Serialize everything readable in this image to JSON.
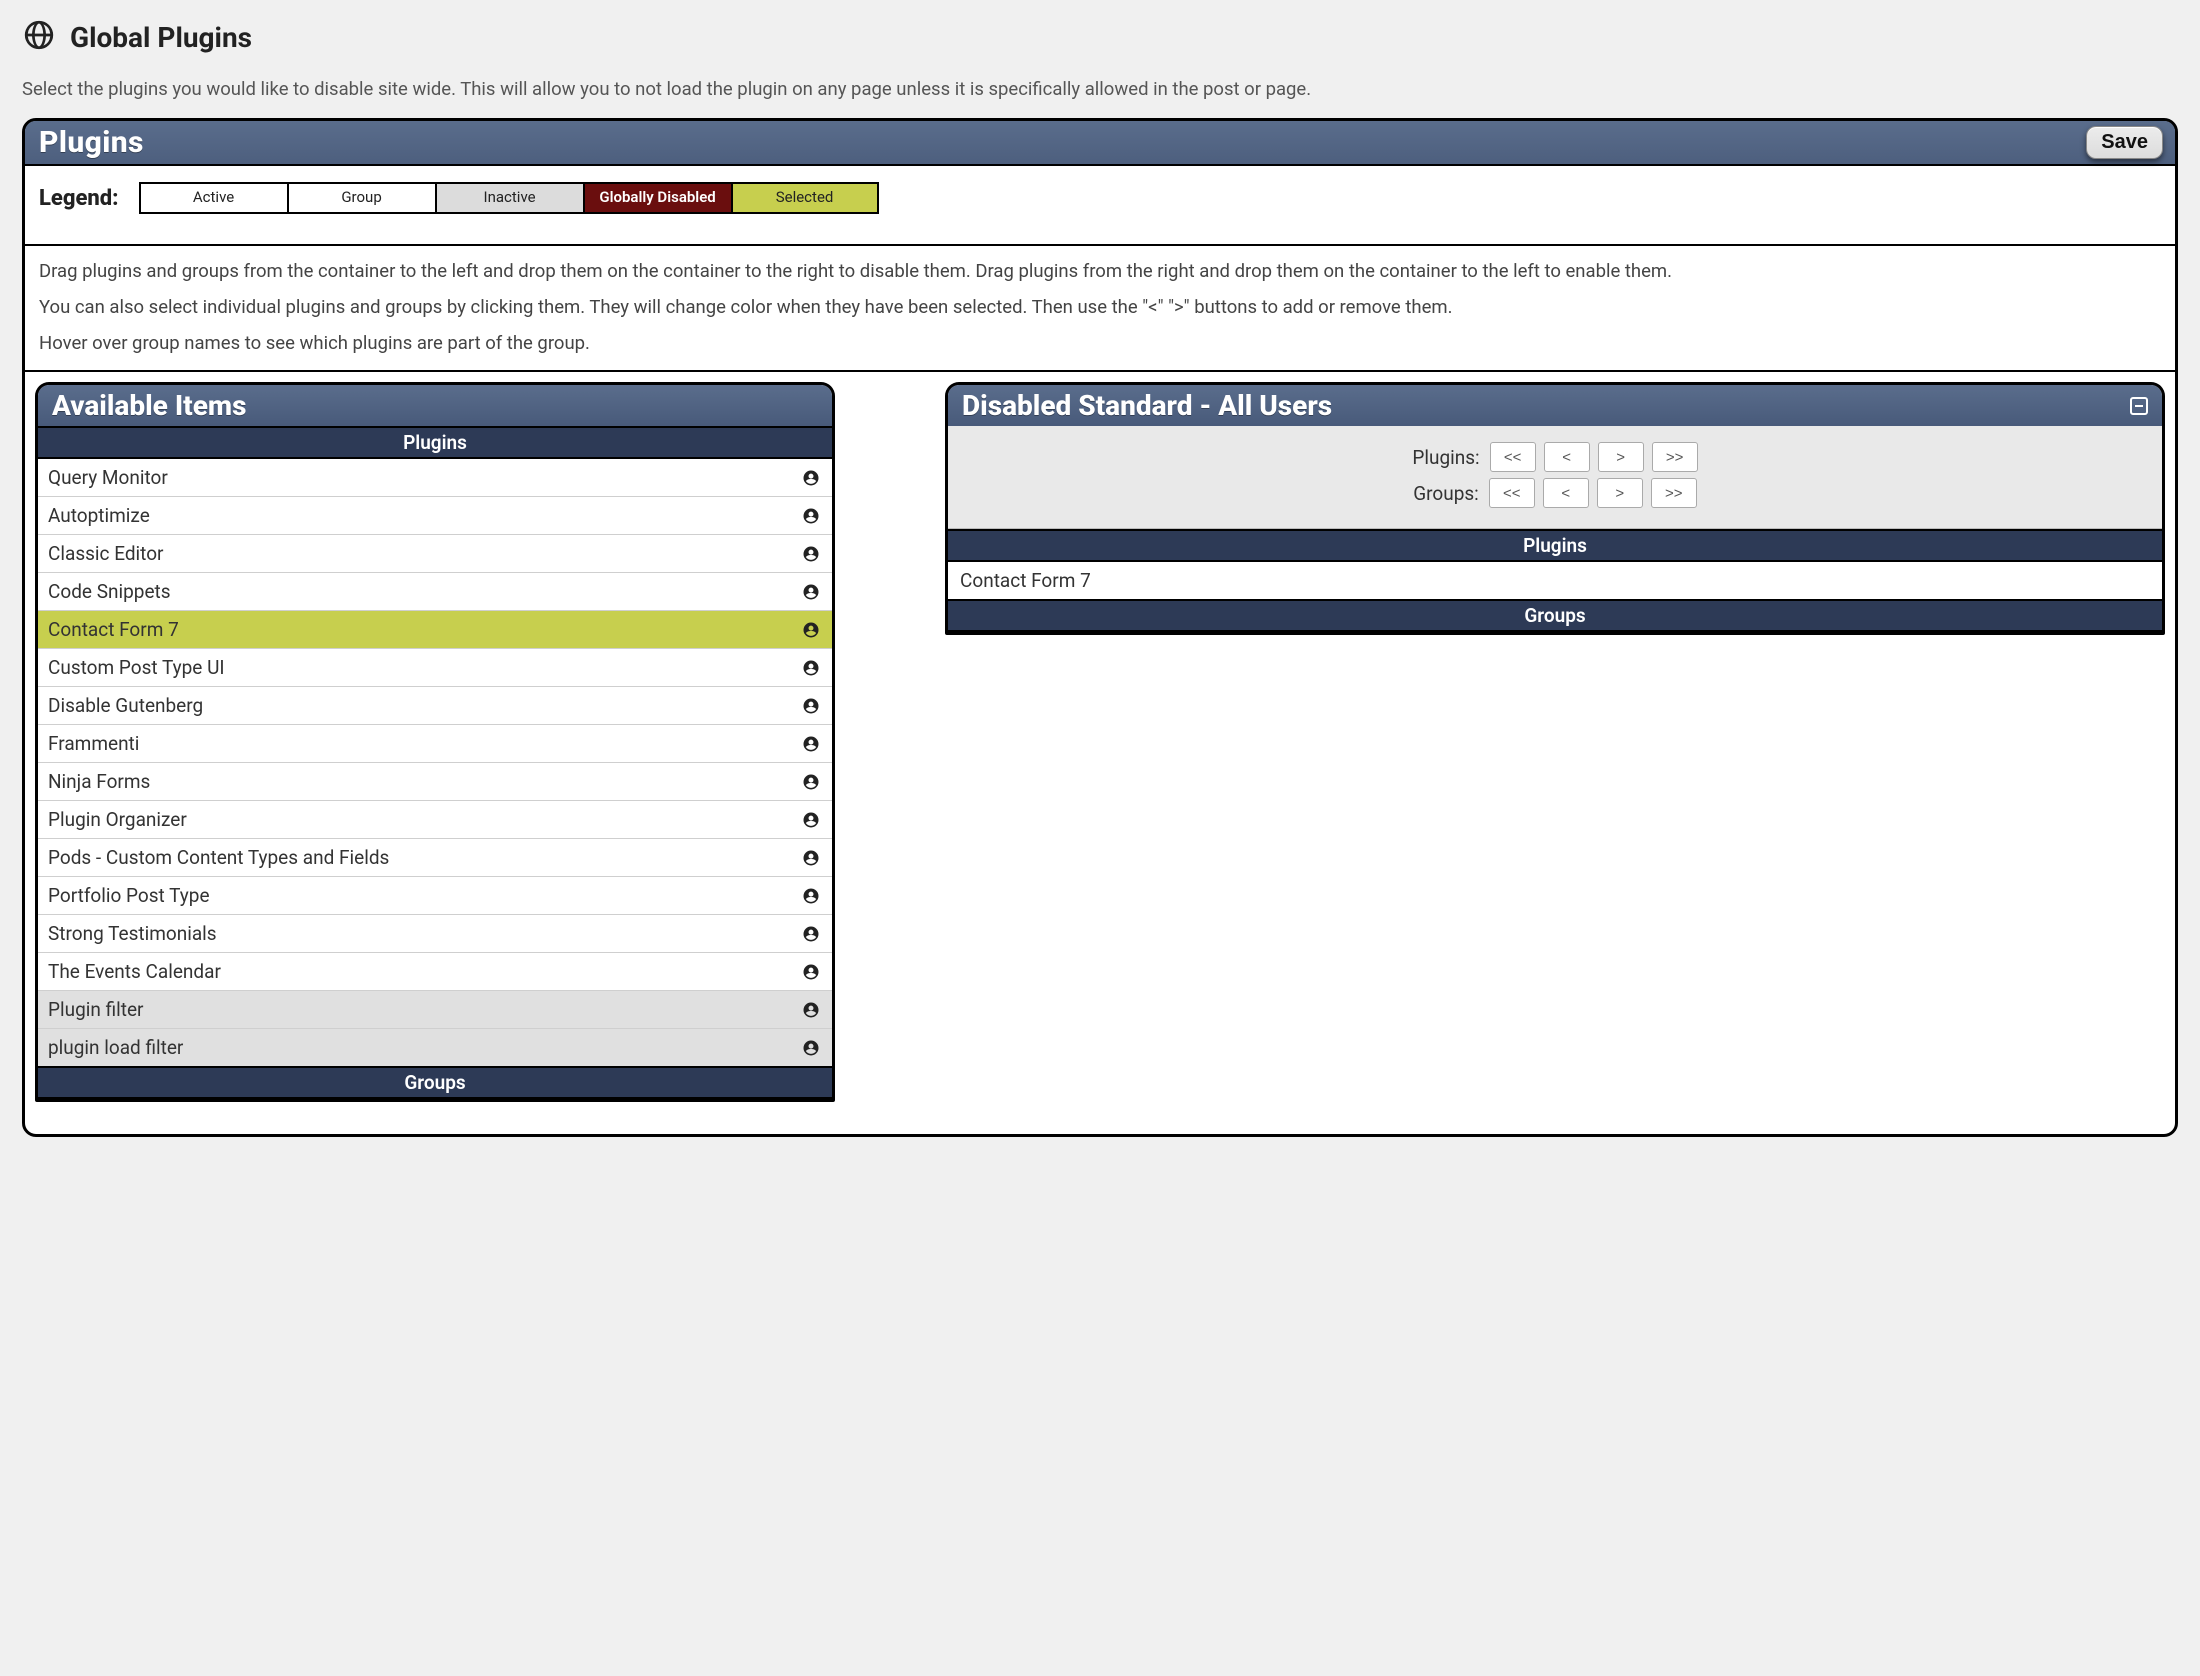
{
  "header": {
    "title": "Global Plugins"
  },
  "intro": "Select the plugins you would like to disable site wide. This will allow you to not load the plugin on any page unless it is specifically allowed in the post or page.",
  "panel": {
    "title": "Plugins",
    "save_label": "Save"
  },
  "legend": {
    "label": "Legend:",
    "active": "Active",
    "group": "Group",
    "inactive": "Inactive",
    "disabled": "Globally Disabled",
    "selected": "Selected"
  },
  "instructions": {
    "p1": "Drag plugins and groups from the container to the left and drop them on the container to the right to disable them. Drag plugins from the right and drop them on the container to the left to enable them.",
    "p2": "You can also select individual plugins and groups by clicking them. They will change color when they have been selected. Then use the \"<\" \">\" buttons to add or remove them.",
    "p3": "Hover over group names to see which plugins are part of the group."
  },
  "left": {
    "title": "Available Items",
    "plugins_label": "Plugins",
    "groups_label": "Groups",
    "items": [
      {
        "name": "Query Monitor",
        "state": "active"
      },
      {
        "name": "Autoptimize",
        "state": "active"
      },
      {
        "name": "Classic Editor",
        "state": "active"
      },
      {
        "name": "Code Snippets",
        "state": "active"
      },
      {
        "name": "Contact Form 7",
        "state": "selected"
      },
      {
        "name": "Custom Post Type UI",
        "state": "active"
      },
      {
        "name": "Disable Gutenberg",
        "state": "active"
      },
      {
        "name": "Frammenti",
        "state": "active"
      },
      {
        "name": "Ninja Forms",
        "state": "active"
      },
      {
        "name": "Plugin Organizer",
        "state": "active"
      },
      {
        "name": "Pods - Custom Content Types and Fields",
        "state": "active"
      },
      {
        "name": "Portfolio Post Type",
        "state": "active"
      },
      {
        "name": "Strong Testimonials",
        "state": "active"
      },
      {
        "name": "The Events Calendar",
        "state": "active"
      },
      {
        "name": "Plugin filter",
        "state": "inactive"
      },
      {
        "name": "plugin load filter",
        "state": "inactive"
      }
    ]
  },
  "right": {
    "title": "Disabled Standard - All Users",
    "controls": {
      "plugins_label": "Plugins:",
      "groups_label": "Groups:",
      "btn_all_left": "<<",
      "btn_left": "<",
      "btn_right": ">",
      "btn_all_right": ">>"
    },
    "plugins_label": "Plugins",
    "groups_label": "Groups",
    "disabled_plugins": [
      {
        "name": "Contact Form 7"
      }
    ]
  }
}
